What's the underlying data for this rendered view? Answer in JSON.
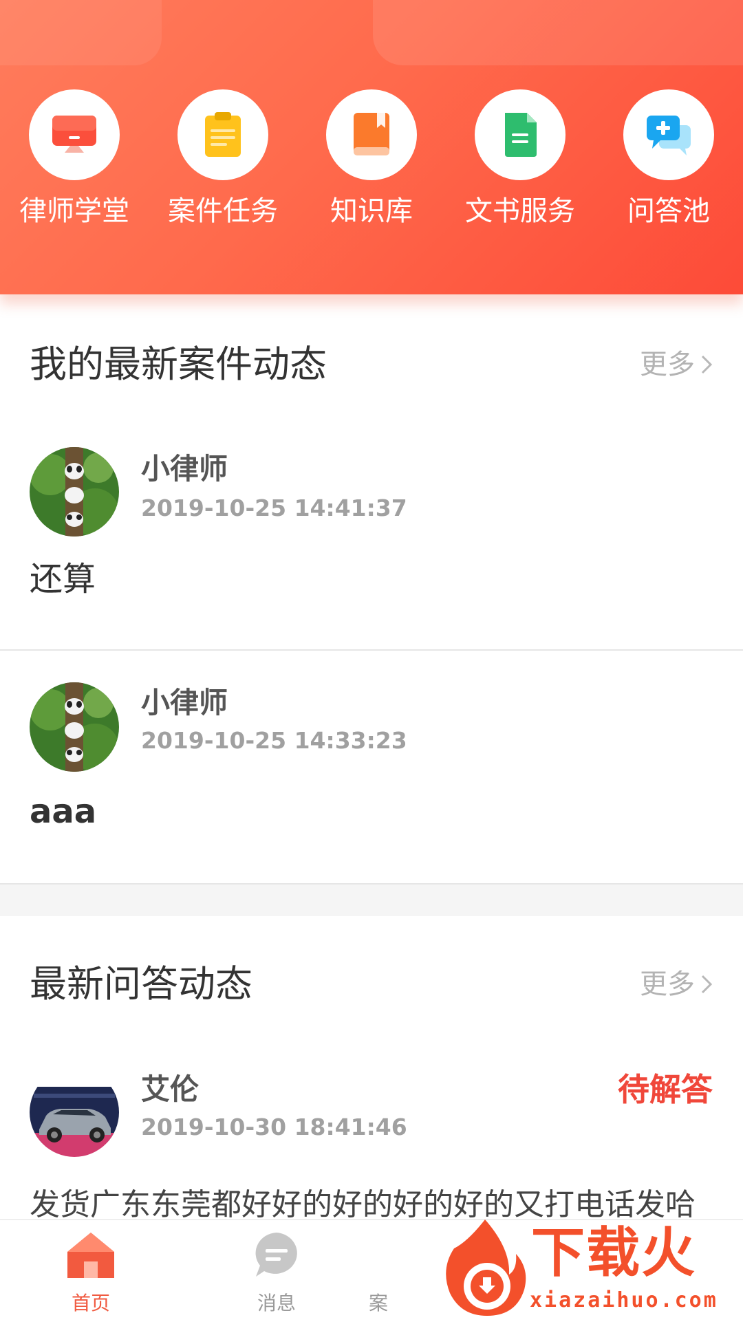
{
  "colors": {
    "brand": "#fd5a40",
    "status_pending": "#f0473a",
    "nav_active": "#f05a40",
    "nav_inactive": "#999999"
  },
  "menu": [
    {
      "label": "律师学堂",
      "icon": "monitor-icon"
    },
    {
      "label": "案件任务",
      "icon": "clipboard-icon"
    },
    {
      "label": "知识库",
      "icon": "book-icon"
    },
    {
      "label": "文书服务",
      "icon": "document-icon"
    },
    {
      "label": "问答池",
      "icon": "chat-plus-icon"
    }
  ],
  "case_section": {
    "title": "我的最新案件动态",
    "more_label": "更多",
    "items": [
      {
        "name": "小律师",
        "time": "2019-10-25 14:41:37",
        "content": "还算",
        "avatar": "panda-avatar"
      },
      {
        "name": "小律师",
        "time": "2019-10-25 14:33:23",
        "content": "aaa",
        "avatar": "panda-avatar"
      }
    ]
  },
  "qa_section": {
    "title": "最新问答动态",
    "more_label": "更多",
    "items": [
      {
        "name": "艾伦",
        "time": "2019-10-30 18:41:46",
        "status": "待解答",
        "content": "发货广东东莞都好好的好的好的好的又打电话发哈",
        "avatar": "car-avatar"
      }
    ]
  },
  "bottom_nav": [
    {
      "label": "首页",
      "icon": "home-icon",
      "active": true
    },
    {
      "label": "消息",
      "icon": "message-icon",
      "active": false
    },
    {
      "label": "案",
      "icon": "case-icon",
      "active": false
    }
  ],
  "watermark": {
    "text": "下载火",
    "url": "xiazaihuo.com"
  }
}
